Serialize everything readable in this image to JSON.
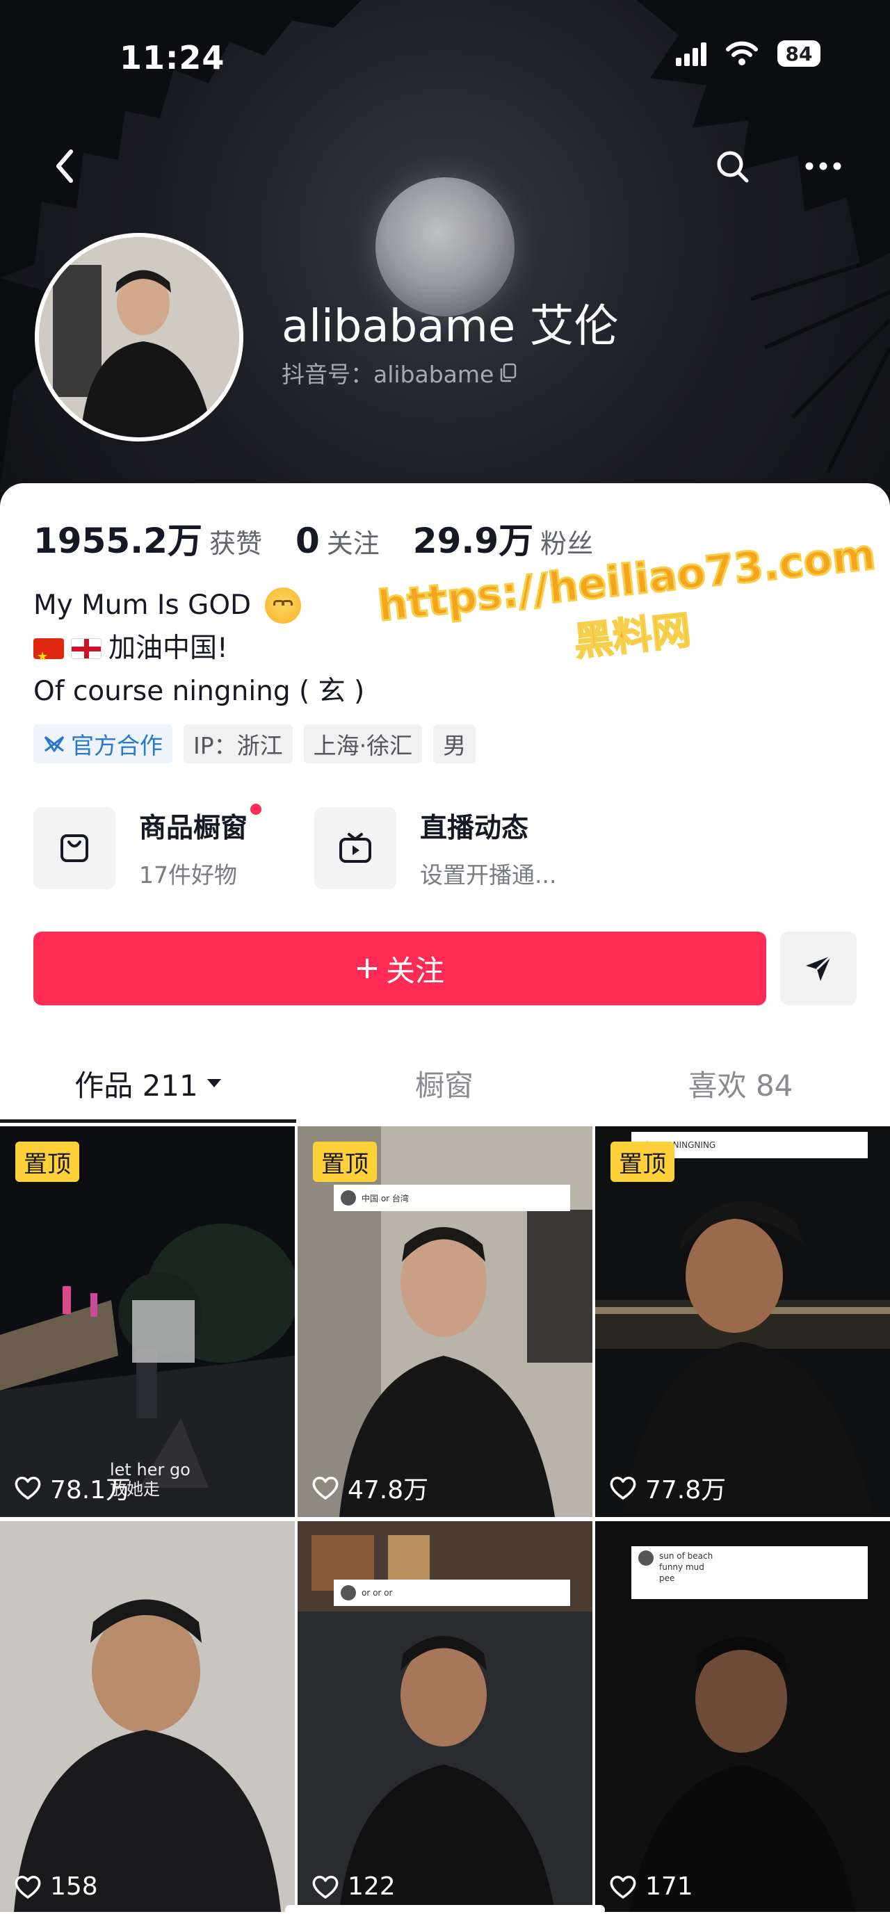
{
  "status_bar": {
    "time": "11:24",
    "battery": "84"
  },
  "profile": {
    "display_name": "alibabame 艾伦",
    "douyin_id": "抖音号：alibabame",
    "stats": [
      {
        "value": "1955.2万",
        "label": "获赞"
      },
      {
        "value": "0",
        "label": "关注"
      },
      {
        "value": "29.9万",
        "label": "粉丝"
      }
    ],
    "bio": {
      "line1": "My Mum Is GOD",
      "line2": "加油中国!",
      "line3": "Of course ningning ( 玄 )"
    },
    "tags": [
      "官方合作",
      "IP：浙江",
      "上海·徐汇",
      "男"
    ]
  },
  "entries": {
    "shop": {
      "title": "商品橱窗",
      "sub": "17件好物"
    },
    "live": {
      "title": "直播动态",
      "sub": "设置开播通..."
    }
  },
  "actions": {
    "follow_label": "关注"
  },
  "tabs": {
    "works": "作品 211",
    "showcase": "橱窗",
    "likes": "喜欢 84"
  },
  "videos": [
    {
      "pinned": "置顶",
      "likes": "78.1万",
      "caption1": "let her go",
      "caption2": "放她走"
    },
    {
      "pinned": "置顶",
      "likes": "47.8万",
      "note": "中国 or 台湾"
    },
    {
      "pinned": "置顶",
      "likes": "77.8万",
      "note": "...ina or NINGNING"
    },
    {
      "likes": "158"
    },
    {
      "likes": "122",
      "note": "or or or"
    },
    {
      "likes": "171",
      "note": "sun of beach funny mud pee"
    }
  ],
  "watermark": {
    "line1": "https://heiliao73.com",
    "line2": "黑料网"
  },
  "colors": {
    "accent": "#fe2c55",
    "pin": "#fed13b",
    "official": "#2b77c9"
  }
}
